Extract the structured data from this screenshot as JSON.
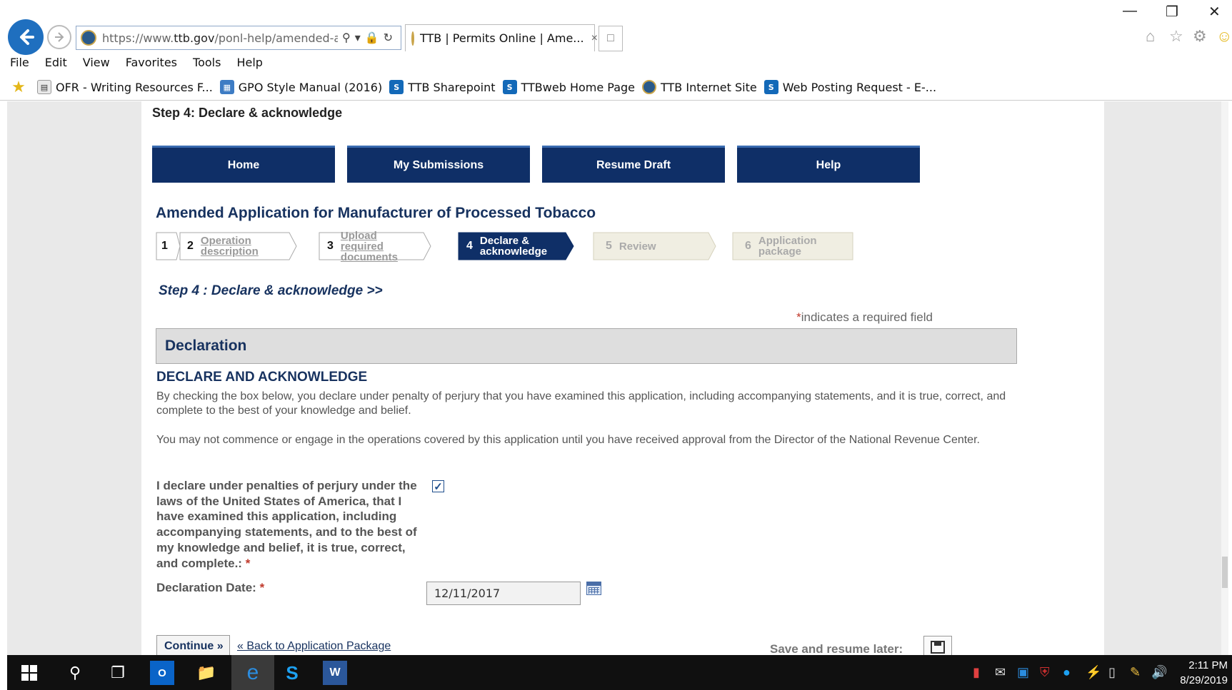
{
  "browser": {
    "url_prefix": "https://www.",
    "url_domain": "ttb.gov",
    "url_rest": "/ponl-help/amended-app",
    "tab_title": "TTB | Permits Online | Ame...",
    "tab_close": "×",
    "menu": [
      "File",
      "Edit",
      "View",
      "Favorites",
      "Tools",
      "Help"
    ],
    "favorites": [
      {
        "label": "OFR - Writing Resources F...",
        "icon": "document-icon"
      },
      {
        "label": "GPO Style Manual (2016)",
        "icon": "gpo-icon"
      },
      {
        "label": "TTB Sharepoint",
        "icon": "sharepoint-icon"
      },
      {
        "label": "TTBweb Home Page",
        "icon": "sharepoint-icon"
      },
      {
        "label": "TTB Internet Site",
        "icon": "seal-icon"
      },
      {
        "label": "Web Posting Request - E-...",
        "icon": "sharepoint-icon"
      }
    ]
  },
  "page": {
    "step_heading": "Step 4: Declare & acknowledge",
    "nav": {
      "home": "Home",
      "submissions": "My Submissions",
      "resume": "Resume Draft",
      "help": "Help"
    },
    "title": "Amended Application for Manufacturer of Processed Tobacco",
    "wizard": {
      "s1_num": "1",
      "s2_num": "2",
      "s2_l1": "Operation",
      "s2_l2": "description",
      "s3_num": "3",
      "s3_l1": "Upload required",
      "s3_l2": "documents",
      "s4_num": "4",
      "s4_l1": "Declare &",
      "s4_l2": "acknowledge",
      "s5_num": "5",
      "s5_l1": "Review",
      "s6_num": "6",
      "s6_l1": "Application",
      "s6_l2": "package"
    },
    "substep": "Step 4 : Declare & acknowledge >>",
    "required_note_star": "*",
    "required_note": "indicates a required field",
    "section_title": "Declaration",
    "declare_heading": "DECLARE AND ACKNOWLEDGE",
    "para1": "By checking the box below, you declare under penalty of perjury that you have examined this application, including accompanying statements, and it is true, correct, and complete to the best of your knowledge and belief.",
    "para2": "You may not commence or engage in the operations covered by this application until you have received approval from the Director of the National Revenue Center.",
    "declaration_label": "I declare under penalties of perjury under the laws of the United States of America, that I have examined this application, including accompanying statements, and to the best of my knowledge and belief, it is true, correct, and complete.:",
    "required_star": "*",
    "checkbox_checked": true,
    "date_label": "Declaration Date:",
    "date_value": "12/11/2017",
    "continue": "Continue »",
    "back_link": "« Back to Application Package",
    "save_later": "Save and resume later:"
  },
  "taskbar": {
    "time": "2:11 PM",
    "date": "8/29/2019"
  },
  "colors": {
    "nav_bg": "#0f2f67",
    "title_text": "#17325f",
    "required": "#c0392b"
  }
}
